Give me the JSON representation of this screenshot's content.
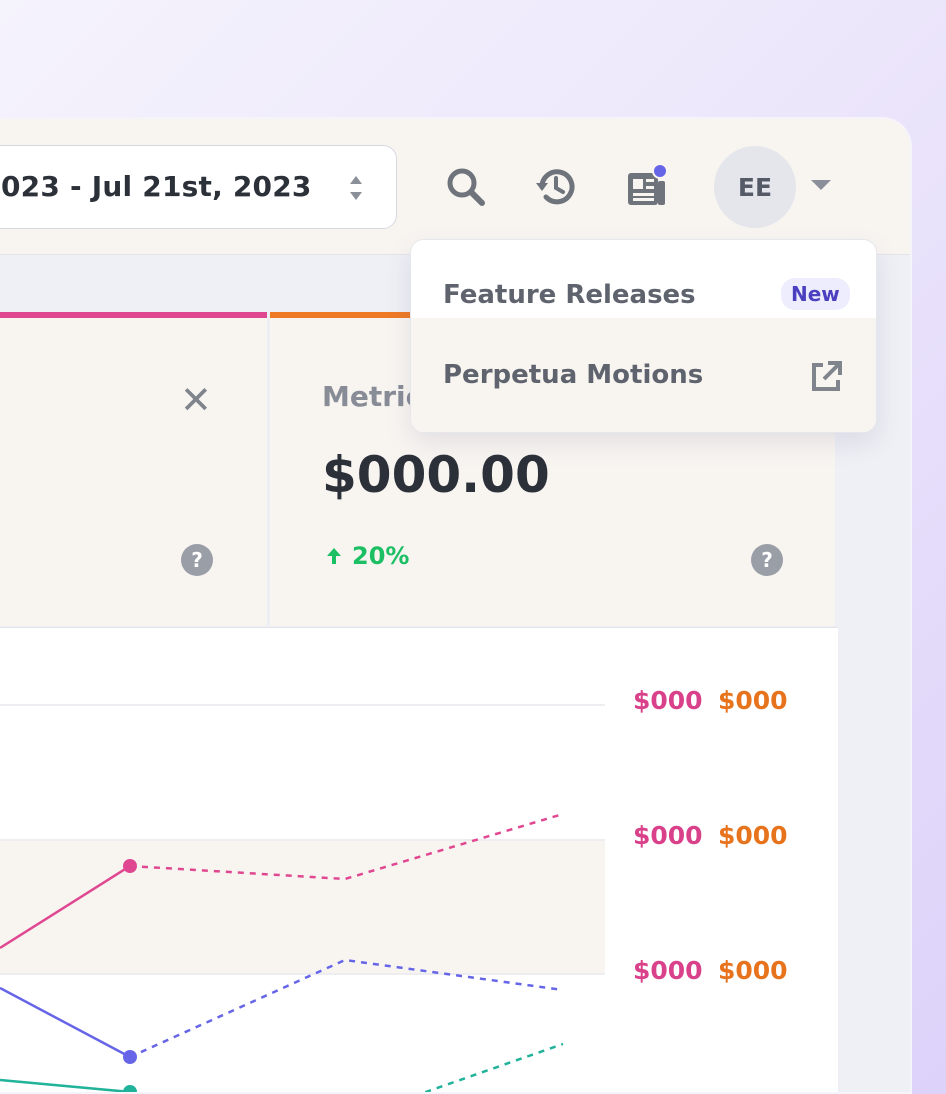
{
  "topbar": {
    "date_range": "023 - Jul 21st, 2023",
    "icons": [
      "search-icon",
      "history-icon",
      "news-icon"
    ],
    "avatar_initials": "EE"
  },
  "dropdown": {
    "items": [
      {
        "label": "Feature Releases",
        "badge": "New"
      },
      {
        "label": "Perpetua Motions",
        "icon": "external-link-icon"
      }
    ]
  },
  "cards": {
    "card1": {
      "accent": "#e04791"
    },
    "card2": {
      "accent": "#ee7a25",
      "label": "Metric",
      "value": "$000.00",
      "change": "20%"
    }
  },
  "chart": {
    "axis_labels": [
      {
        "left": "$000",
        "right": "$000"
      },
      {
        "left": "$000",
        "right": "$000"
      },
      {
        "left": "$000",
        "right": "$000"
      }
    ],
    "colors": {
      "pink": "#e04791",
      "orange": "#ee7a25",
      "purple": "#6665e8",
      "teal": "#20b39a"
    }
  }
}
